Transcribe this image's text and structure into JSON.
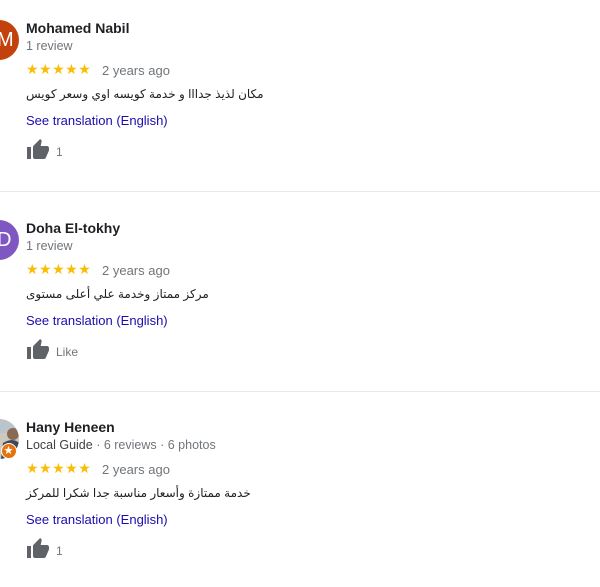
{
  "reviews": [
    {
      "initial": "M",
      "avatar_color": "#c2410c",
      "name": "Mohamed Nabil",
      "local_guide": "",
      "stats": "1 review",
      "rating": 5,
      "stars": "★★★★★",
      "date": "2 years ago",
      "text": "مكان لذيذ جدااا و خدمة كويسه اوي وسعر كويس",
      "translate_label": "See translation (English)",
      "like_label": "1"
    },
    {
      "initial": "D",
      "avatar_color": "#7e57c2",
      "name": "Doha El-tokhy",
      "local_guide": "",
      "stats": "1 review",
      "rating": 5,
      "stars": "★★★★★",
      "date": "2 years ago",
      "text": "مركز ممتاز وخدمة  علي أعلى مستوى",
      "translate_label": "See translation (English)",
      "like_label": "Like"
    },
    {
      "initial": "",
      "avatar_color": "#d9d4cc",
      "name": "Hany Heneen",
      "local_guide": "Local Guide",
      "stats": "· 6 reviews · 6 photos",
      "rating": 5,
      "stars": "★★★★★",
      "date": "2 years ago",
      "text": "خدمة ممتازة وأسعار مناسبة جدا شكرا للمركز",
      "translate_label": "See translation (English)",
      "like_label": "1"
    }
  ],
  "colors": {
    "star": "#fbbc04",
    "link": "#1a0dab",
    "divider": "#e8eaed",
    "local_guide_badge": "#e8710a"
  }
}
